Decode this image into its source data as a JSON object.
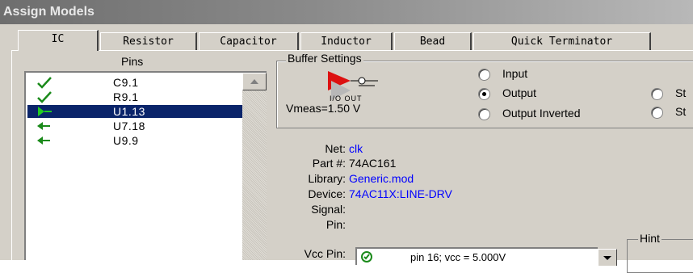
{
  "window": {
    "title": "Assign Models"
  },
  "tabs": [
    {
      "label": "IC"
    },
    {
      "label": "Resistor"
    },
    {
      "label": "Capacitor"
    },
    {
      "label": "Inductor"
    },
    {
      "label": "Bead"
    },
    {
      "label": "Quick Terminator"
    }
  ],
  "pins": {
    "header": "Pins",
    "items": [
      {
        "name": "C9.1",
        "icon": "checkmark-icon",
        "selected": false
      },
      {
        "name": "R9.1",
        "icon": "checkmark-icon",
        "selected": false
      },
      {
        "name": "U1.13",
        "icon": "driver-output-icon",
        "selected": true
      },
      {
        "name": "U7.18",
        "icon": "receiver-arrow-icon",
        "selected": false
      },
      {
        "name": "U9.9",
        "icon": "receiver-arrow-icon",
        "selected": false
      }
    ]
  },
  "buffer_settings": {
    "title": "Buffer Settings",
    "buffer_io_label": "I/O OUT",
    "vmeas": "Vmeas=1.50 V",
    "options": [
      {
        "label": "Input",
        "checked": false
      },
      {
        "label": "Output",
        "checked": true
      },
      {
        "label": "Output Inverted",
        "checked": false
      },
      {
        "label": "St",
        "checked": false
      },
      {
        "label": "St",
        "checked": false
      }
    ]
  },
  "info": {
    "net_label": "Net:",
    "net_value": "clk",
    "part_label": "Part #:",
    "part_value": "74AC161",
    "library_label": "Library:",
    "library_value": "Generic.mod",
    "device_label": "Device:",
    "device_value": "74AC11X:LINE-DRV",
    "signal_label": "Signal:",
    "signal_value": "",
    "pin_label": "Pin:",
    "pin_value": ""
  },
  "vcc": {
    "label": "Vcc Pin:",
    "value": "pin 16; vcc = 5.000V"
  },
  "hint": {
    "title": "Hint"
  },
  "colors": {
    "selection": "#0a246a",
    "link_blue": "#0000ff",
    "check_green": "#1a8a1a"
  }
}
